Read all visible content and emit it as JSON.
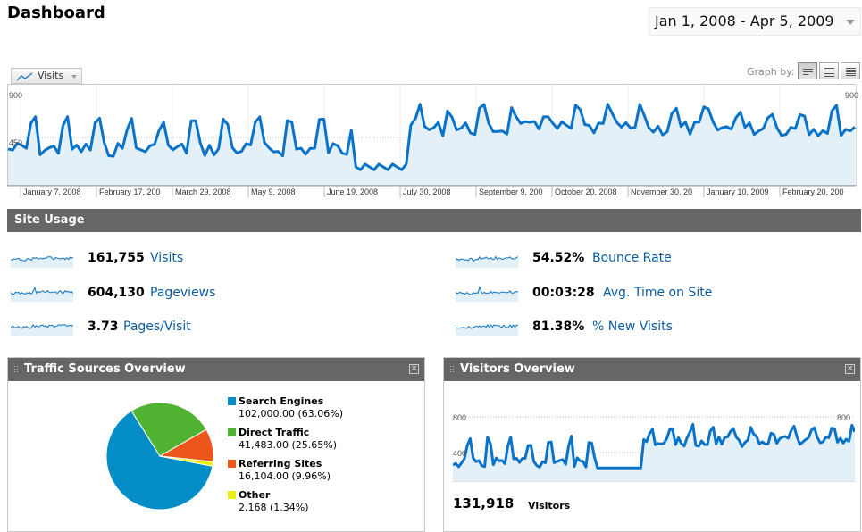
{
  "header": {
    "title": "Dashboard",
    "date_range": "Jan 1, 2008 - Apr 5, 2009"
  },
  "graph_controls": {
    "metric_label": "Visits",
    "graph_by_label": "Graph by:",
    "buttons": [
      "day-view-icon",
      "week-view-icon",
      "month-view-icon"
    ]
  },
  "main_chart": {
    "y_labels": [
      "900",
      "450"
    ],
    "y_label_right": "900",
    "x_labels": [
      "January 7, 2008",
      "February 17, 200",
      "March 29, 2008",
      "May 9, 2008",
      "June 19, 2008",
      "July 30, 2008",
      "September 9, 200",
      "October 20, 2008",
      "November 30, 20",
      "January 10, 2009",
      "February 20, 200"
    ]
  },
  "site_usage": {
    "title": "Site Usage",
    "metrics": [
      {
        "value": "161,755",
        "label": "Visits"
      },
      {
        "value": "604,130",
        "label": "Pageviews"
      },
      {
        "value": "3.73",
        "label": "Pages/Visit"
      },
      {
        "value": "54.52%",
        "label": "Bounce Rate"
      },
      {
        "value": "00:03:28",
        "label": "Avg. Time on Site"
      },
      {
        "value": "81.38%",
        "label": "% New Visits"
      }
    ]
  },
  "traffic_sources": {
    "title": "Traffic Sources Overview",
    "legend": [
      {
        "name": "Search Engines",
        "value": "102,000.00 (63.06%)",
        "color": "#058dc7",
        "percent": 63.06
      },
      {
        "name": "Direct Traffic",
        "value": "41,483.00 (25.65%)",
        "color": "#50b432",
        "percent": 25.65
      },
      {
        "name": "Referring Sites",
        "value": "16,104.00 (9.96%)",
        "color": "#ed561b",
        "percent": 9.96
      },
      {
        "name": "Other",
        "value": "2,168 (1.34%)",
        "color": "#edef00",
        "percent": 1.34
      }
    ]
  },
  "visitors": {
    "title": "Visitors Overview",
    "y_label_top": "800",
    "y_label_mid": "400",
    "y_label_right": "800",
    "count": "131,918",
    "count_label": "Visitors"
  },
  "colors": {
    "line": "#0b73c7",
    "area": "#e4f0f8",
    "header_bar": "#666666",
    "link": "#0b5ba1"
  }
}
